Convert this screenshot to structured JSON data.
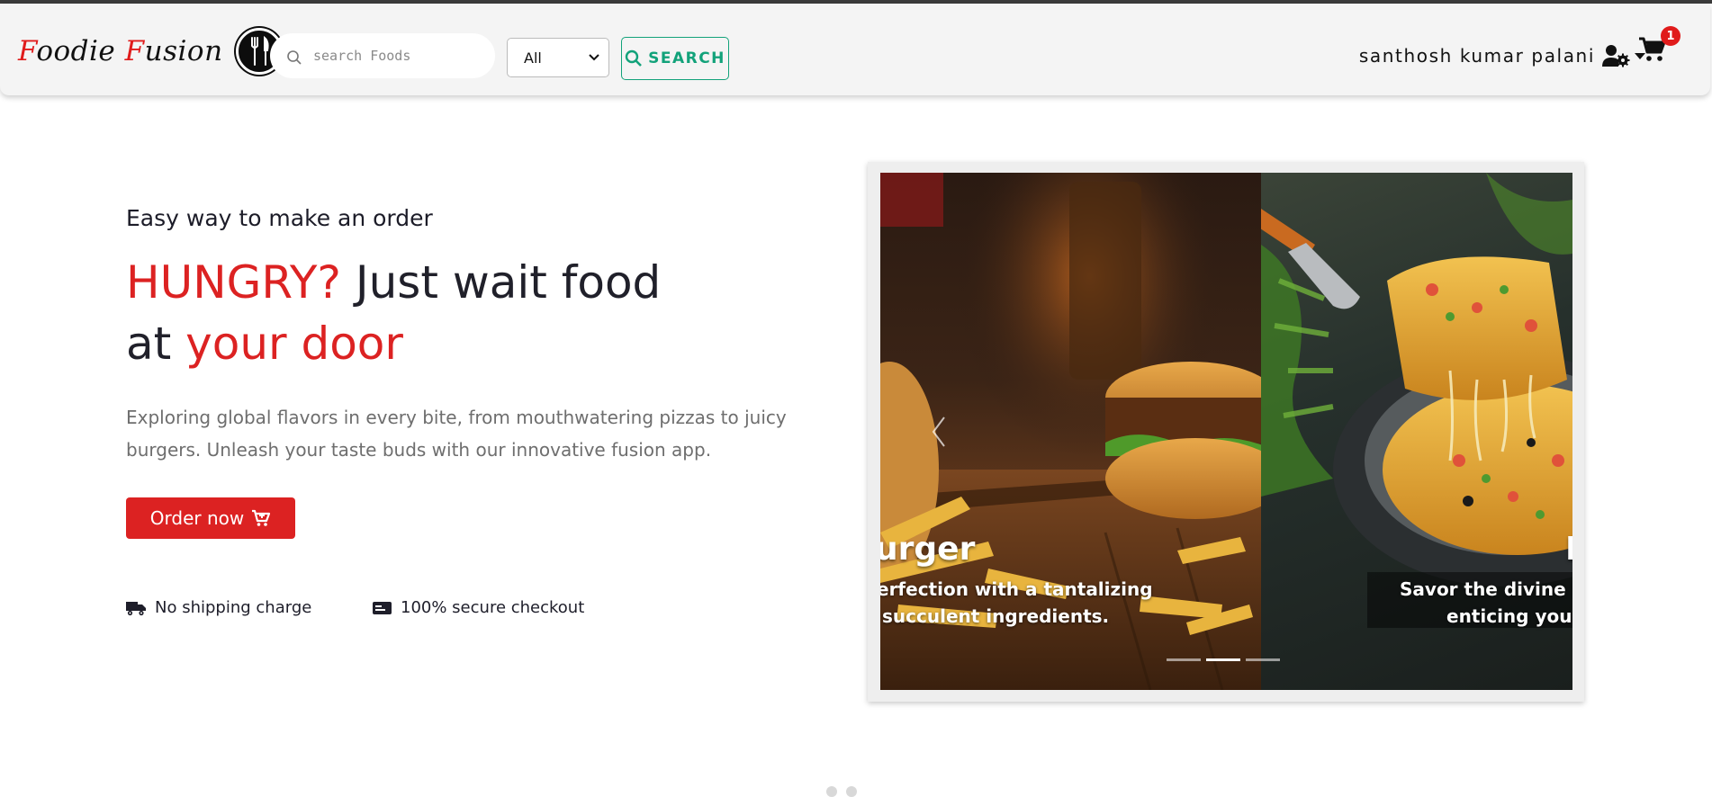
{
  "brand": {
    "first_letter": "F",
    "first_rest": "oodie ",
    "second_letter": "F",
    "second_rest": "usion"
  },
  "search": {
    "placeholder": "search Foods",
    "value": ""
  },
  "category": {
    "selected": "All"
  },
  "search_button": {
    "label": "SEARCH"
  },
  "user": {
    "name": "santhosh kumar palani"
  },
  "cart": {
    "count": "1"
  },
  "hero": {
    "kicker": "Easy way to make an order",
    "title_hungry": "HUNGRY?",
    "title_mid": " Just wait food at ",
    "title_door": "your door",
    "description": "Exploring global flavors in every bite, from mouthwatering pizzas to juicy burgers. Unleash your taste buds with our innovative fusion app.",
    "order_label": "Order now"
  },
  "features": [
    {
      "label": "No shipping charge",
      "icon": "truck-icon"
    },
    {
      "label": "100% secure checkout",
      "icon": "card-icon"
    }
  ],
  "carousel": {
    "slides": [
      {
        "title": "urger",
        "line1": "erfection with a tantalizing",
        "line2": "succulent ingredients."
      },
      {
        "title": "P",
        "line1": "Savor the divine fla",
        "line2": "enticing you wi"
      }
    ],
    "active_index": 1,
    "count": 3
  },
  "colors": {
    "brand_red": "#dc2222",
    "search_green": "#12a27a",
    "badge_red": "#e01b1b"
  }
}
